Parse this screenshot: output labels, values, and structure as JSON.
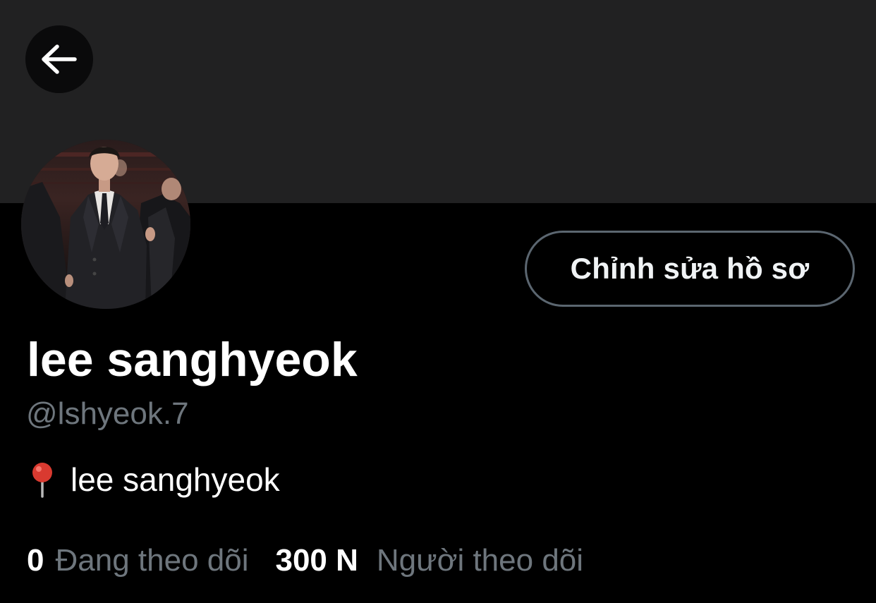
{
  "header": {
    "back_icon": "arrow-left-icon",
    "banner_color": "#212122"
  },
  "profile": {
    "avatar_icon": "profile-photo",
    "edit_button_label": "Chỉnh sửa hồ sơ",
    "display_name": "lee sanghyeok",
    "handle": "@lshyeok.7",
    "bio": {
      "icon": "round-pushpin-icon",
      "text": "lee sanghyeok"
    }
  },
  "stats": {
    "following": {
      "count": "0",
      "label": "Đang theo dõi"
    },
    "followers": {
      "count": "300 N",
      "label": "Người theo dõi"
    }
  },
  "colors": {
    "background": "#000000",
    "secondary_text": "#6e767d",
    "button_border": "#5b6670"
  }
}
